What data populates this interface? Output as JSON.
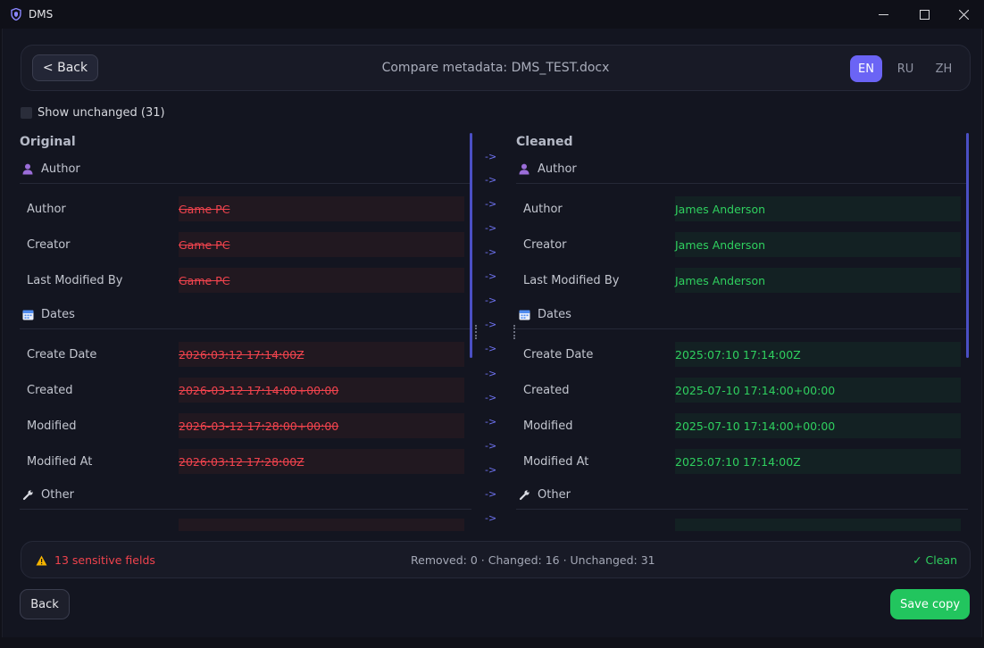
{
  "window": {
    "title": "DMS"
  },
  "header": {
    "back_label": "< Back",
    "title": "Compare metadata: DMS_TEST.docx",
    "languages": [
      "EN",
      "RU",
      "ZH"
    ],
    "active_language": "EN"
  },
  "filter": {
    "show_unchanged_label": "Show unchanged (31)",
    "checked": false
  },
  "original": {
    "title": "Original",
    "sections": [
      {
        "name": "Author",
        "icon": "user-icon",
        "rows": [
          {
            "label": "Author",
            "value": "Game PC"
          },
          {
            "label": "Creator",
            "value": "Game PC"
          },
          {
            "label": "Last Modified By",
            "value": "Game PC"
          }
        ]
      },
      {
        "name": "Dates",
        "icon": "calendar-icon",
        "rows": [
          {
            "label": "Create Date",
            "value": "2026:03:12 17:14:00Z"
          },
          {
            "label": "Created",
            "value": "2026-03-12 17:14:00+00:00"
          },
          {
            "label": "Modified",
            "value": "2026-03-12 17:28:00+00:00"
          },
          {
            "label": "Modified At",
            "value": "2026:03:12 17:28:00Z"
          }
        ]
      },
      {
        "name": "Other",
        "icon": "wrench-icon",
        "rows": []
      }
    ]
  },
  "cleaned": {
    "title": "Cleaned",
    "sections": [
      {
        "name": "Author",
        "icon": "user-icon",
        "rows": [
          {
            "label": "Author",
            "value": "James Anderson"
          },
          {
            "label": "Creator",
            "value": "James Anderson"
          },
          {
            "label": "Last Modified By",
            "value": "James Anderson"
          }
        ]
      },
      {
        "name": "Dates",
        "icon": "calendar-icon",
        "rows": [
          {
            "label": "Create Date",
            "value": "2025:07:10 17:14:00Z"
          },
          {
            "label": "Created",
            "value": "2025-07-10 17:14:00+00:00"
          },
          {
            "label": "Modified",
            "value": "2025-07-10 17:14:00+00:00"
          },
          {
            "label": "Modified At",
            "value": "2025:07:10 17:14:00Z"
          }
        ]
      },
      {
        "name": "Other",
        "icon": "wrench-icon",
        "rows": []
      }
    ]
  },
  "arrow_symbol": "->",
  "status": {
    "sensitive": "13 sensitive fields",
    "counts": "Removed: 0  ·  Changed: 16  ·  Unchanged: 31",
    "clean": "✓ Clean"
  },
  "footer": {
    "back_label": "Back",
    "save_label": "Save copy"
  },
  "colors": {
    "accent": "#6b64f5",
    "removed": "#f0434d",
    "clean": "#2fd05f",
    "save": "#22c55e"
  }
}
